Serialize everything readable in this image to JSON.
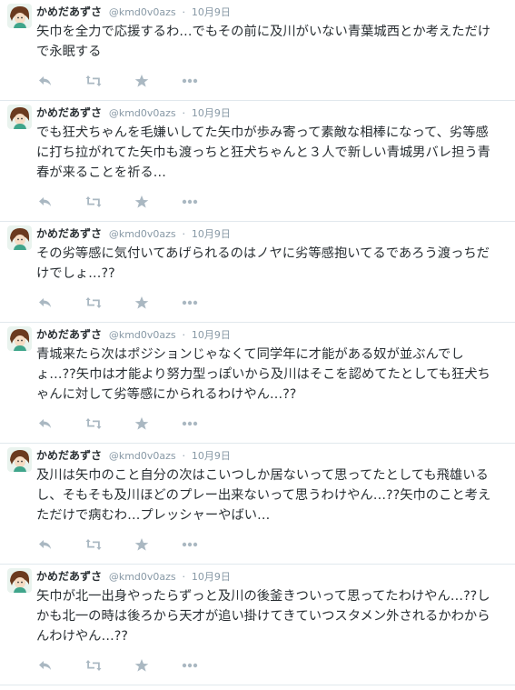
{
  "tweets": [
    {
      "name": "かめだあずさ",
      "handle": "@kmd0v0azs",
      "separator": "·",
      "time": "10月9日",
      "text": "矢巾を全力で応援するわ…でもその前に及川がいない青葉城西とか考えただけで永眠する"
    },
    {
      "name": "かめだあずさ",
      "handle": "@kmd0v0azs",
      "separator": "·",
      "time": "10月9日",
      "text": "でも狂犬ちゃんを毛嫌いしてた矢巾が歩み寄って素敵な相棒になって、劣等感に打ち拉がれてた矢巾も渡っちと狂犬ちゃんと３人で新しい青城男バレ担う青春が来ることを祈る…"
    },
    {
      "name": "かめだあずさ",
      "handle": "@kmd0v0azs",
      "separator": "·",
      "time": "10月9日",
      "text": "その劣等感に気付いてあげられるのはノヤに劣等感抱いてるであろう渡っちだけでしょ…??"
    },
    {
      "name": "かめだあずさ",
      "handle": "@kmd0v0azs",
      "separator": "·",
      "time": "10月9日",
      "text": "青城来たら次はポジションじゃなくて同学年に才能がある奴が並ぶんでしょ…??矢巾は才能より努力型っぽいから及川はそこを認めてたとしても狂犬ちゃんに対して劣等感にかられるわけやん…??"
    },
    {
      "name": "かめだあずさ",
      "handle": "@kmd0v0azs",
      "separator": "·",
      "time": "10月9日",
      "text": "及川は矢巾のこと自分の次はこいつしか居ないって思ってたとしても飛雄いるし、そもそも及川ほどのプレー出来ないって思うわけやん…??矢巾のこと考えただけで病むわ…プレッシャーやばい…"
    },
    {
      "name": "かめだあずさ",
      "handle": "@kmd0v0azs",
      "separator": "·",
      "time": "10月9日",
      "text": "矢巾が北一出身やったらずっと及川の後釜きついって思ってたわけやん…??しかも北一の時は後ろから天才が追い掛けてきていつスタメン外されるかわからんわけやん…??"
    }
  ]
}
